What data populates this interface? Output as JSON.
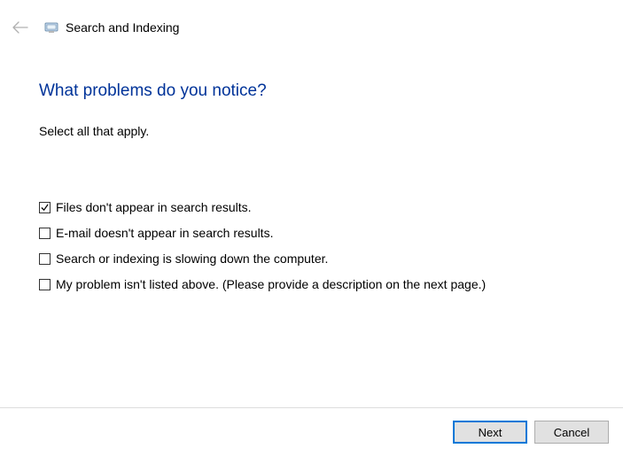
{
  "header": {
    "title": "Search and Indexing"
  },
  "main": {
    "heading": "What problems do you notice?",
    "subtitle": "Select all that apply.",
    "options": [
      {
        "label": "Files don't appear in search results.",
        "checked": true
      },
      {
        "label": "E-mail doesn't appear in search results.",
        "checked": false
      },
      {
        "label": "Search or indexing is slowing down the computer.",
        "checked": false
      },
      {
        "label": "My problem isn't listed above. (Please provide a description on the next page.)",
        "checked": false
      }
    ]
  },
  "footer": {
    "next_label": "Next",
    "cancel_label": "Cancel"
  }
}
